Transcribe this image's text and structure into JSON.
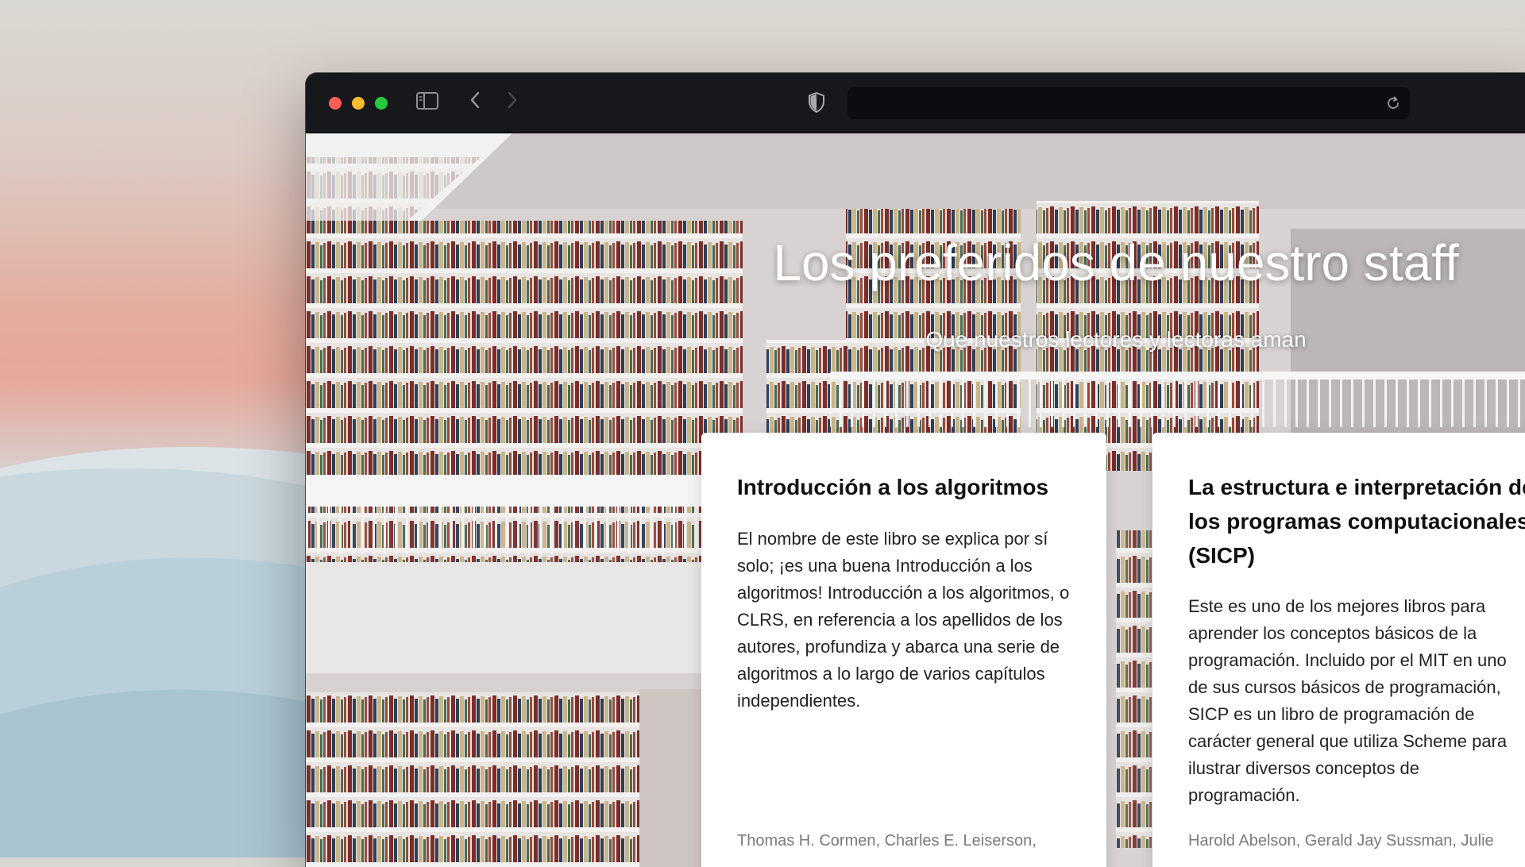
{
  "browser": {
    "address": "",
    "icons": {
      "sidebar": "sidebar-icon",
      "back": "chevron-left-icon",
      "forward": "chevron-right-icon",
      "privacy": "shield-icon",
      "reload": "reload-icon"
    }
  },
  "hero": {
    "title": "Los preferidos de nuestro staff",
    "subtitle": "Que nuestros lectores y lectoras aman"
  },
  "books": [
    {
      "title": "Introducción a los algoritmos",
      "description": "El nombre de este libro se explica por sí solo; ¡es una buena Introducción a los algoritmos! Introducción a los algoritmos, o CLRS, en referencia a los apellidos de los autores, profundiza y abarca una serie de algoritmos a lo largo de varios capítulos independientes.",
      "authors": "Thomas H. Cormen, Charles E. Leiserson,"
    },
    {
      "title": "La estructura e interpretación de los programas computacionales (SICP)",
      "description": "Este es uno de los mejores libros para aprender los conceptos básicos de la programación. Incluido por el MIT en uno de sus cursos básicos de programación, SICP es un libro de programación de carácter general que utiliza Scheme para ilustrar diversos conceptos de programación.",
      "authors": "Harold Abelson, Gerald Jay Sussman, Julie"
    }
  ],
  "colors": {
    "titlebar": "#17181b",
    "traffic_red": "#fe5f57",
    "traffic_yellow": "#febc2e",
    "traffic_green": "#28c840"
  }
}
